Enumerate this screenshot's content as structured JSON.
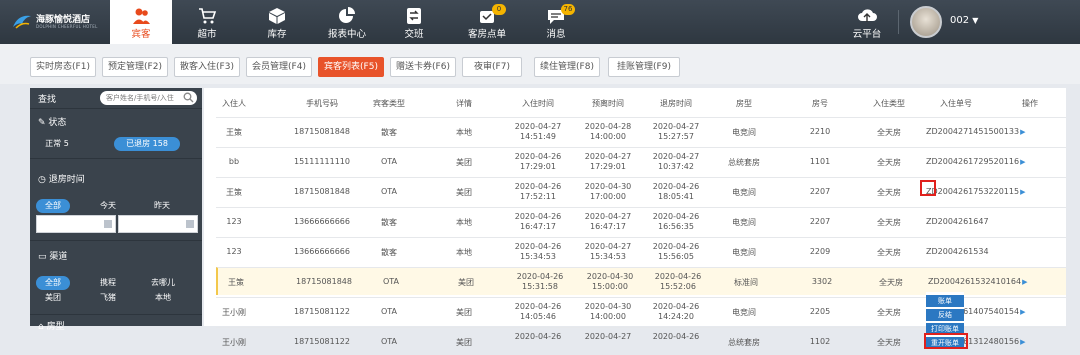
{
  "brand": {
    "name": "海豚愉悦酒店",
    "subtitle": "DOLPHIN CHEERFUL HOTEL"
  },
  "nav": [
    {
      "label": "宾客",
      "icon": "guests-icon",
      "active": true
    },
    {
      "label": "超市",
      "icon": "cart-icon"
    },
    {
      "label": "库存",
      "icon": "box-icon"
    },
    {
      "label": "报表中心",
      "icon": "pie-chart-icon"
    },
    {
      "label": "交班",
      "icon": "handover-icon"
    },
    {
      "label": "客房点单",
      "icon": "room-order-icon",
      "badge": "0"
    },
    {
      "label": "消息",
      "icon": "message-icon",
      "badge": "76"
    },
    {
      "label": "云平台",
      "icon": "cloud-upload-icon"
    }
  ],
  "user": {
    "name": "002",
    "icon": "chevron-down-icon"
  },
  "tabs": [
    "实时房态(F1)",
    "预定管理(F2)",
    "散客入住(F3)",
    "会员管理(F4)",
    "宾客列表(F5)",
    "赠送卡券(F6)",
    "夜审(F7)",
    "续住管理(F8)",
    "挂账管理(F9)"
  ],
  "active_tab": "宾客列表(F5)",
  "sidebar": {
    "search_label": "查找",
    "search_placeholder": "客户姓名/手机号/入住",
    "status_title": "状态",
    "status_normal": "正常 5",
    "status_checked_out": "已退房 158",
    "checkout_title": "退房时间",
    "checkout_options": [
      "全部",
      "今天",
      "昨天"
    ],
    "channel_title": "渠道",
    "channel_options": [
      "全部",
      "携程",
      "去哪儿",
      "美团",
      "飞猪",
      "本地"
    ],
    "next_section_title": "房型"
  },
  "table": {
    "headers": [
      "入住人",
      "手机号码",
      "宾客类型",
      "详情",
      "入住时间",
      "预离时间",
      "退房时间",
      "房型",
      "房号",
      "入住类型",
      "入住单号",
      "操作"
    ],
    "rows": [
      [
        "王策",
        "18715081848",
        "散客",
        "本地",
        "2020-04-27",
        "14:51:49",
        "2020-04-28",
        "14:00:00",
        "2020-04-27",
        "15:27:57",
        "电竞间",
        "2210",
        "全天房",
        "ZD2004271451500133"
      ],
      [
        "bb",
        "15111111110",
        "OTA",
        "美团",
        "2020-04-26",
        "17:29:01",
        "2020-04-27",
        "17:29:01",
        "2020-04-27",
        "10:37:42",
        "总统套房",
        "1101",
        "全天房",
        "ZD2004261729520116"
      ],
      [
        "王策",
        "18715081848",
        "OTA",
        "美团",
        "2020-04-26",
        "17:52:11",
        "2020-04-30",
        "17:00:00",
        "2020-04-26",
        "18:05:41",
        "电竞间",
        "2207",
        "全天房",
        "ZD2004261753220115"
      ],
      [
        "123",
        "13666666666",
        "散客",
        "本地",
        "2020-04-26",
        "16:47:17",
        "2020-04-27",
        "16:47:17",
        "2020-04-26",
        "16:56:35",
        "电竞间",
        "2207",
        "全天房",
        "ZD2004261647"
      ],
      [
        "123",
        "13666666666",
        "散客",
        "本地",
        "2020-04-26",
        "15:34:53",
        "2020-04-27",
        "15:34:53",
        "2020-04-26",
        "15:56:05",
        "电竞间",
        "2209",
        "全天房",
        "ZD2004261534"
      ],
      [
        "王策",
        "18715081848",
        "OTA",
        "美团",
        "2020-04-26",
        "15:31:58",
        "2020-04-30",
        "15:00:00",
        "2020-04-26",
        "15:52:06",
        "标准间",
        "3302",
        "全天房",
        "ZD2004261532410164"
      ],
      [
        "王小刚",
        "18715081122",
        "OTA",
        "美团",
        "2020-04-26",
        "14:05:46",
        "2020-04-30",
        "14:00:00",
        "2020-04-26",
        "14:24:20",
        "电竞间",
        "2205",
        "全天房",
        "ZD2004261407540154"
      ],
      [
        "王小刚",
        "18715081122",
        "OTA",
        "美团",
        "2020-04-26",
        "",
        "2020-04-27",
        "",
        "2020-04-26",
        "",
        "总统套房",
        "1102",
        "全天房",
        "ZD2004261312480156"
      ]
    ]
  },
  "context_menu": [
    "账单",
    "反结",
    "打印账单",
    "重开账单"
  ]
}
